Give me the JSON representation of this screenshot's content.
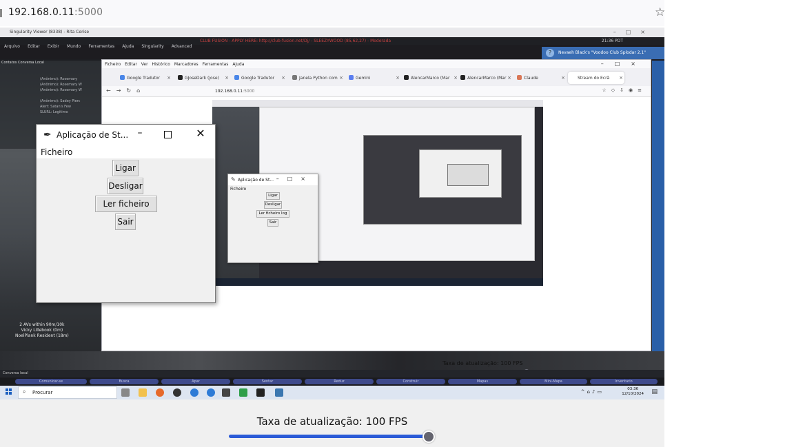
{
  "browser": {
    "url_host": "192.168.0.11",
    "url_port": ":5000",
    "star_icon": "star-icon"
  },
  "remote": {
    "sl_title": "Singularity Viewer (8338) - Rita Cerise",
    "sl_menu": [
      "Arquivo",
      "Editar",
      "Exibir",
      "Mundo",
      "Ferramentas",
      "Ajuda",
      "Singularity",
      "Advanced"
    ],
    "sl_menu_red": "CLUB FUSION - APPLY HERE: http://club-fusion.net/Dj/ - SLEEZYWOOD (85,62,27) - Moderada",
    "sl_time": "21:36 PDT",
    "notification": "Nevaeh Black's \"Voodoo Club Splodar 2.1\"",
    "chat_tabs": "Contatos  Conversa Local",
    "chat_lines": [
      "(Anônimo): Rosemary",
      "(Anônimo): Rosemary W",
      "(Anônimo): Rosemary W",
      "(Anônimo): Sadey Pierc",
      "Alert: Satan's Few",
      "SLURL: Legitimo"
    ],
    "avatar_text": [
      "2 AVs within 90m/10k",
      "Vicky Lillebook (0m)",
      "NoelPlank Resident (18m)"
    ],
    "firefox": {
      "menu": [
        "Ficheiro",
        "Editar",
        "Ver",
        "Histórico",
        "Marcadores",
        "Ferramentas",
        "Ajuda"
      ],
      "tabs": [
        {
          "label": "Google Tradutor",
          "color": "#4a86e8"
        },
        {
          "label": "GJoseDark (jose)",
          "color": "#222222"
        },
        {
          "label": "Google Tradutor",
          "color": "#4a86e8"
        },
        {
          "label": "Janela Python com",
          "color": "#777777"
        },
        {
          "label": "Gemini",
          "color": "#5b7ef0"
        },
        {
          "label": "AlencarMarco (Mar",
          "color": "#222222"
        },
        {
          "label": "AlencarMarco (Mar",
          "color": "#222222"
        },
        {
          "label": "Claude",
          "color": "#d97757"
        },
        {
          "label": "Stream do Ecrã",
          "color": "#dddddd"
        }
      ],
      "url_host": "192.168.0.11",
      "url_port": ":5000"
    },
    "tk_mid": {
      "title": "Aplicação de St...",
      "menu": "Ficheiro",
      "buttons": [
        "Ligar",
        "Desligar",
        "Ler ficheiro log",
        "Sair"
      ]
    },
    "mid_fps_label": "Taxa de atualização: 100 FPS",
    "sl_bottom_pills": [
      "Comunicar-se",
      "Busca",
      "Apar",
      "Sentar",
      "Reduz",
      "Construir",
      "Mapas",
      "Mini-Mapa",
      "Inventario"
    ],
    "sl_bottom_left": "Conversa local",
    "taskbar": {
      "search_placeholder": "Procurar",
      "time": "03:36",
      "date": "12/10/2024"
    }
  },
  "tk_main": {
    "title": "Aplicação de St...",
    "menu_file": "Ficheiro",
    "buttons": {
      "on": "Ligar",
      "off": "Desligar",
      "read_log": "Ler ficheiro log",
      "exit": "Sair"
    }
  },
  "fps": {
    "label": "Taxa de atualização: 100 FPS",
    "value": 100,
    "slider_fraction": 0.97
  },
  "colors": {
    "accent": "#2b5bd7",
    "slider_thumb": "#64646e"
  }
}
